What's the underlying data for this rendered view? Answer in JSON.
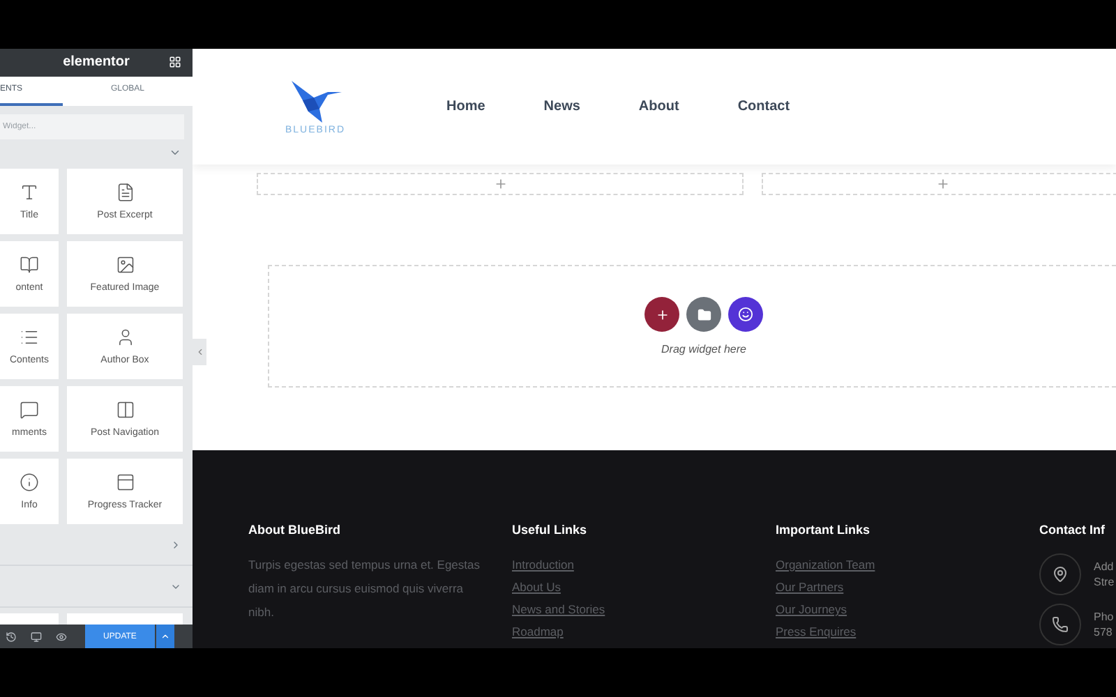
{
  "panel": {
    "title": "elementor",
    "tabs": [
      {
        "label": "ENTS",
        "selected": true
      },
      {
        "label": "GLOBAL",
        "selected": false
      }
    ],
    "search": {
      "placeholder": "Widget..."
    },
    "widgets": [
      {
        "label": "Title"
      },
      {
        "label": "Post Excerpt"
      },
      {
        "label": "ontent"
      },
      {
        "label": "Featured Image"
      },
      {
        "label": "Contents"
      },
      {
        "label": "Author Box"
      },
      {
        "label": "mments"
      },
      {
        "label": "Post Navigation"
      },
      {
        "label": "Info"
      },
      {
        "label": "Progress Tracker"
      }
    ],
    "sections": [
      {
        "expanded": true
      },
      {
        "expanded": false
      },
      {
        "expanded": true
      }
    ],
    "update_button": "UPDATE"
  },
  "site_header": {
    "logo": "BLUEBIRD",
    "nav": [
      {
        "label": "Home"
      },
      {
        "label": "News"
      },
      {
        "label": "About"
      },
      {
        "label": "Contact"
      }
    ]
  },
  "drop_zone": {
    "hint": "Drag widget here"
  },
  "footer": {
    "columns": [
      {
        "kind": "text",
        "title": "About BlueBird",
        "text": "Turpis egestas sed tempus urna et. Egestas diam in arcu cursus euismod quis viverra nibh."
      },
      {
        "kind": "links",
        "title": "Useful Links",
        "links": [
          "Introduction",
          "About Us",
          "News and Stories",
          "Roadmap"
        ]
      },
      {
        "kind": "links",
        "title": "Important Links",
        "links": [
          "Organization Team",
          "Our Partners",
          "Our Journeys",
          "Press Enquires"
        ]
      },
      {
        "kind": "contact",
        "title": "Contact Inf",
        "items": [
          {
            "lines": [
              "Add",
              "Stre"
            ]
          },
          {
            "lines": [
              "Pho",
              "578"
            ]
          }
        ]
      }
    ]
  }
}
